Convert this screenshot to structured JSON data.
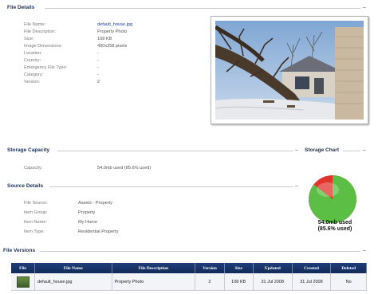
{
  "file_details": {
    "title": "File Details",
    "fields": [
      {
        "label": "File Name:",
        "value": "default_house.jpg"
      },
      {
        "label": "File Description:",
        "value": "Property Photo"
      },
      {
        "label": "Size:",
        "value": "108 KB"
      },
      {
        "label": "Image Dimensions:",
        "value": "400x358 pixels"
      },
      {
        "label": "Location:",
        "value": "-"
      },
      {
        "label": "Country:",
        "value": "-"
      },
      {
        "label": "Emergency File Type:",
        "value": "-"
      },
      {
        "label": "Category:",
        "value": "-"
      },
      {
        "label": "Version:",
        "value": "2"
      }
    ]
  },
  "storage": {
    "title": "Storage Capacity",
    "capacity_label": "Capacity:",
    "capacity_value": "54.0mb used (85.6% used)"
  },
  "storage_chart": {
    "title": "Storage Chart",
    "used_text": "54.0mb used",
    "percent_text": "(85.6% used)",
    "used_percent": 85.6,
    "colors": {
      "used": "#5cbf45",
      "free": "#e0352b"
    }
  },
  "source_details": {
    "title": "Source Details",
    "fields": [
      {
        "label": "File Source:",
        "value": "Assets - Property"
      },
      {
        "label": "Item Group:",
        "value": "Property"
      },
      {
        "label": "Item Name:",
        "value": "My Home"
      },
      {
        "label": "Item Type:",
        "value": "Residential Property"
      }
    ]
  },
  "file_versions": {
    "title": "File Versions",
    "columns": [
      "File",
      "File Name",
      "File Description",
      "Version",
      "Size",
      "Updated",
      "Created",
      "Deleted"
    ],
    "rows": [
      {
        "file_name": "default_house.jpg",
        "description": "Property Photo",
        "version": "2",
        "size": "108 KB",
        "updated": "31 Jul 2008",
        "created": "31 Jul 2008",
        "deleted": "No"
      }
    ]
  },
  "icons": {
    "collapse": "collapse-icon",
    "thumbnail": "image-thumbnail-icon"
  }
}
